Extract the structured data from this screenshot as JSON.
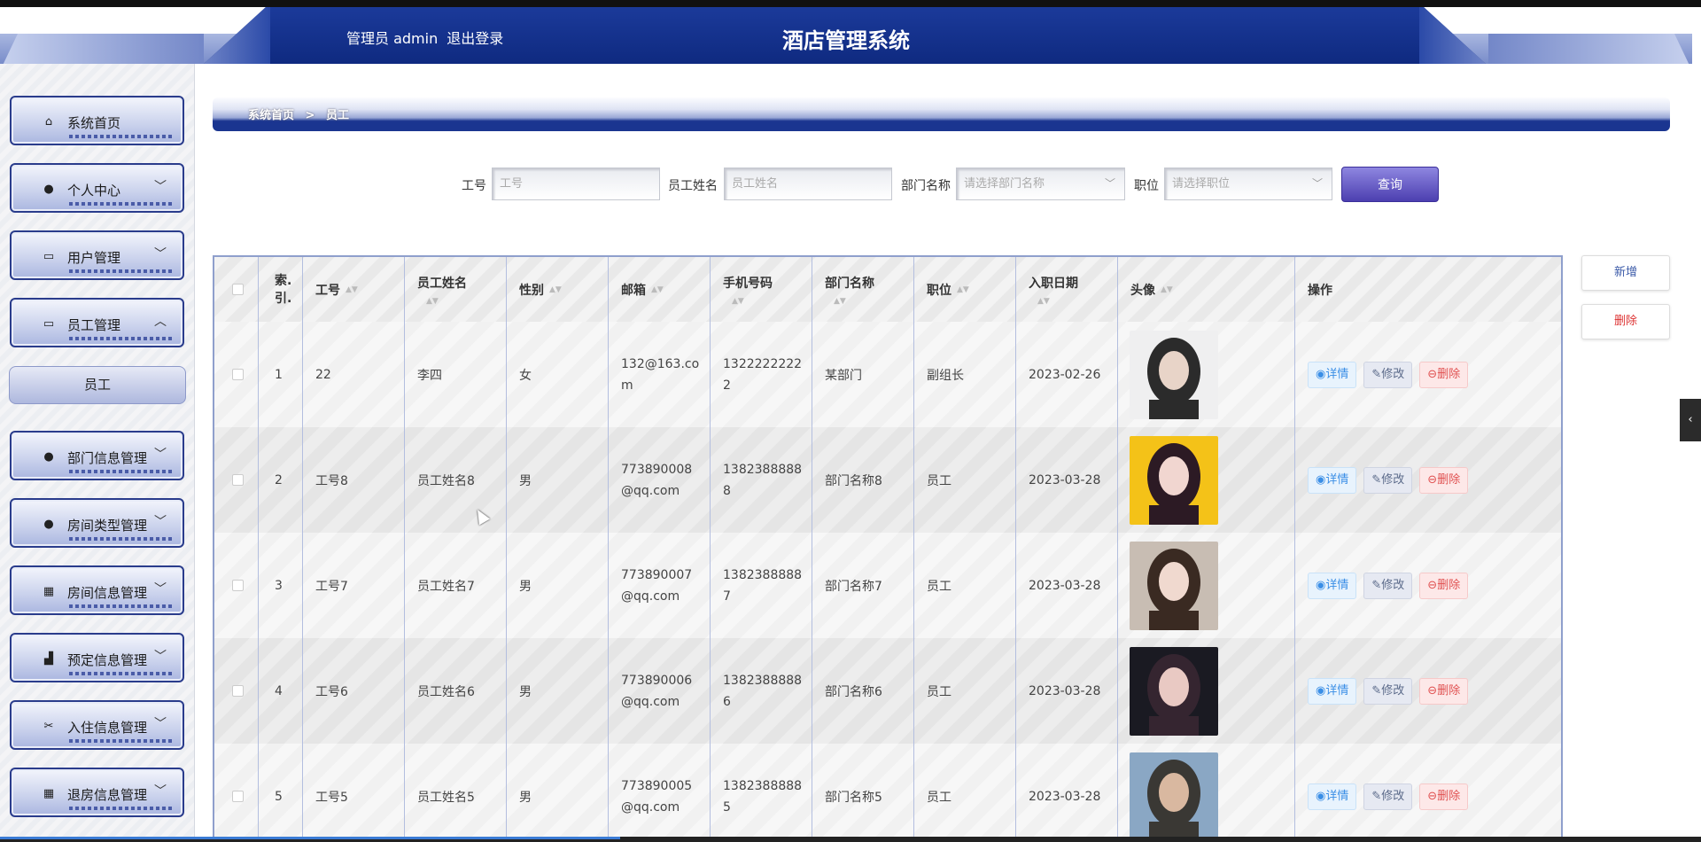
{
  "header": {
    "admin_label": "管理员 admin",
    "logout": "退出登录",
    "title": "酒店管理系统"
  },
  "sidebar": {
    "items": [
      {
        "label": "系统首页",
        "icon": "home-icon",
        "glyph": "⌂",
        "arrow": ""
      },
      {
        "label": "个人中心",
        "icon": "user-icon",
        "glyph": "●",
        "arrow": "﹀"
      },
      {
        "label": "用户管理",
        "icon": "monitor-icon",
        "glyph": "▭",
        "arrow": "﹀"
      },
      {
        "label": "员工管理",
        "icon": "monitor-icon",
        "glyph": "▭",
        "arrow": "︿"
      },
      {
        "label": "部门信息管理",
        "icon": "pin-icon",
        "glyph": "●",
        "arrow": "﹀"
      },
      {
        "label": "房间类型管理",
        "icon": "user-icon",
        "glyph": "●",
        "arrow": "﹀"
      },
      {
        "label": "房间信息管理",
        "icon": "grid-icon",
        "glyph": "▦",
        "arrow": "﹀"
      },
      {
        "label": "预定信息管理",
        "icon": "thumb-icon",
        "glyph": "▟",
        "arrow": "﹀"
      },
      {
        "label": "入住信息管理",
        "icon": "ticket-icon",
        "glyph": "✂",
        "arrow": "﹀"
      },
      {
        "label": "退房信息管理",
        "icon": "grid-icon",
        "glyph": "▦",
        "arrow": "﹀"
      }
    ],
    "sub_item": "员工"
  },
  "breadcrumb": {
    "home": "系统首页",
    "sep": ">",
    "current": "员工"
  },
  "search": {
    "gh_label": "工号",
    "gh_placeholder": "工号",
    "name_label": "员工姓名",
    "name_placeholder": "员工姓名",
    "dept_label": "部门名称",
    "dept_placeholder": "请选择部门名称",
    "pos_label": "职位",
    "pos_placeholder": "请选择职位",
    "query": "查询"
  },
  "actions": {
    "add": "新增",
    "delete": "删除"
  },
  "table": {
    "headers": [
      "索.引.",
      "工号",
      "员工姓名",
      "性别",
      "邮箱",
      "手机号码",
      "部门名称",
      "职位",
      "入职日期",
      "头像",
      "操作"
    ],
    "action_labels": {
      "detail": "详情",
      "edit": "修改",
      "delete": "删除"
    },
    "rows": [
      {
        "idx": "1",
        "gh": "22",
        "name": "李四",
        "sex": "女",
        "email": "132@163.com",
        "phone": "13222222222",
        "dept": "某部门",
        "pos": "副组长",
        "date": "2023-02-26"
      },
      {
        "idx": "2",
        "gh": "工号8",
        "name": "员工姓名8",
        "sex": "男",
        "email": "773890008@qq.com",
        "phone": "13823888888",
        "dept": "部门名称8",
        "pos": "员工",
        "date": "2023-03-28"
      },
      {
        "idx": "3",
        "gh": "工号7",
        "name": "员工姓名7",
        "sex": "男",
        "email": "773890007@qq.com",
        "phone": "13823888887",
        "dept": "部门名称7",
        "pos": "员工",
        "date": "2023-03-28"
      },
      {
        "idx": "4",
        "gh": "工号6",
        "name": "员工姓名6",
        "sex": "男",
        "email": "773890006@qq.com",
        "phone": "13823888886",
        "dept": "部门名称6",
        "pos": "员工",
        "date": "2023-03-28"
      },
      {
        "idx": "5",
        "gh": "工号5",
        "name": "员工姓名5",
        "sex": "男",
        "email": "773890005@qq.com",
        "phone": "13823888885",
        "dept": "部门名称5",
        "pos": "员工",
        "date": "2023-03-28"
      }
    ]
  },
  "colors": {
    "header_blue": "#14318c",
    "accent_purple": "#5a4dbf",
    "detail_blue": "#3a8ee6",
    "delete_red": "#e05050"
  }
}
